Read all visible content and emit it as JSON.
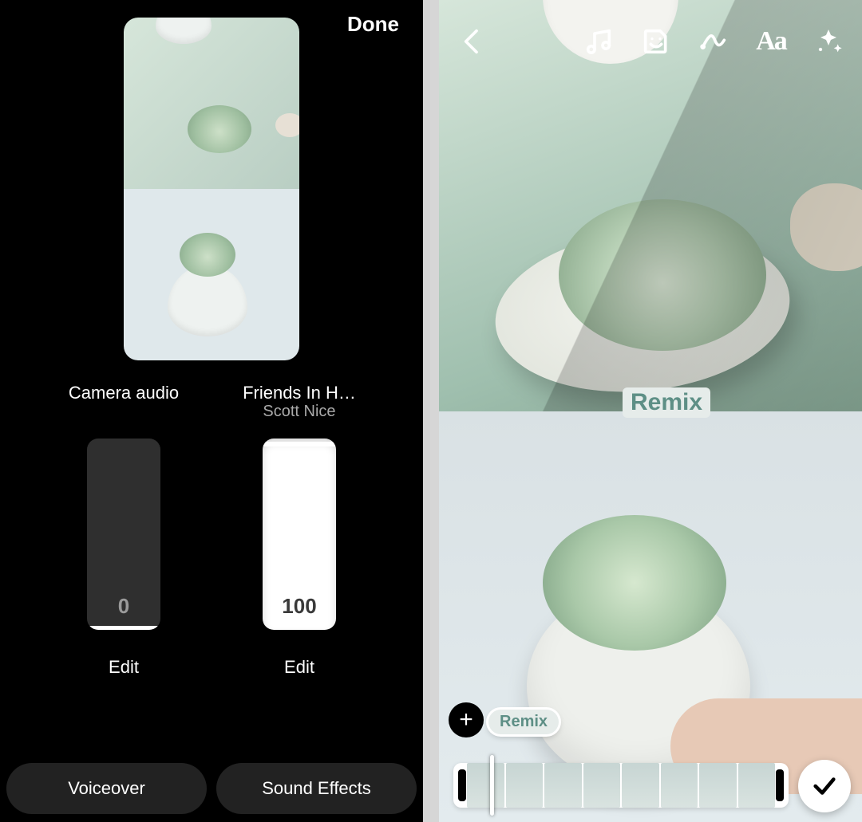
{
  "left_pane": {
    "done_label": "Done",
    "audio_channels": [
      {
        "title": "Camera audio",
        "subtitle": "",
        "level": 0,
        "level_text": "0",
        "edit_label": "Edit"
      },
      {
        "title": "Friends In H…",
        "subtitle": "Scott Nice",
        "level": 100,
        "level_text": "100",
        "edit_label": "Edit"
      }
    ],
    "bottom_buttons": {
      "voiceover": "Voiceover",
      "sound_effects": "Sound Effects"
    }
  },
  "right_pane": {
    "toolbar_icons": {
      "back": "back-icon",
      "music": "music-note-icon",
      "sticker": "sticker-icon",
      "effects": "draw-effects-icon",
      "text": "Aa",
      "sparkle": "sparkle-icon"
    },
    "overlay_label_big": "Remix",
    "clip_pill_label": "Remix",
    "add_clip_symbol": "+",
    "timeline": {
      "frame_count": 8
    },
    "confirm_icon": "check-icon"
  },
  "colors": {
    "remix_text": "#5e8f86",
    "remix_bg": "#e6ecea"
  }
}
